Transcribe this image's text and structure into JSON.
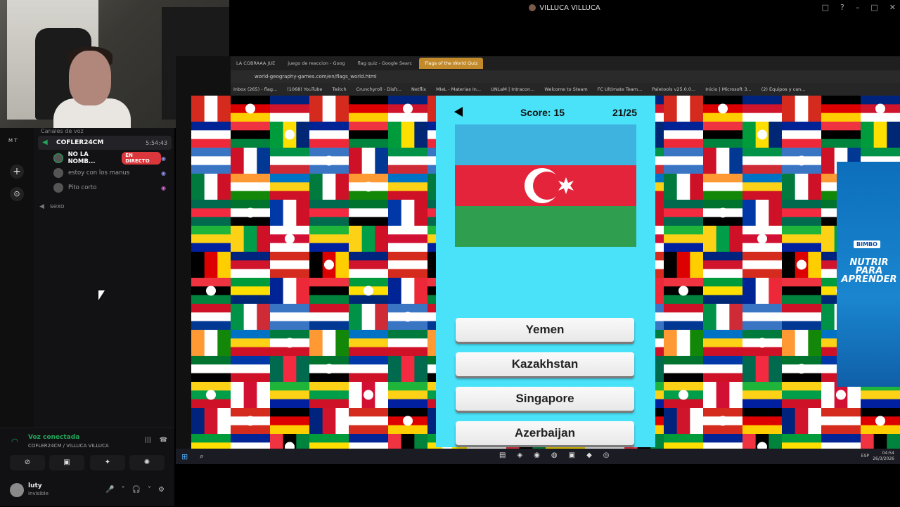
{
  "window": {
    "title": "VILLUCA VILLUCA",
    "controls": [
      "□",
      "?",
      "–",
      "□",
      "✕"
    ]
  },
  "server_bar": {
    "initials": "M T",
    "add_label": "+",
    "explore_label": "⊙"
  },
  "channels": {
    "section_title": "Canales de voz",
    "active_channel": {
      "name": "COFLER24CM",
      "timer": "5:54:43"
    },
    "users": [
      {
        "name": "NO LA NOMB...",
        "badge": "EN DIRECTO",
        "icon": "game-controller-icon"
      },
      {
        "name": "estoy con los manus",
        "badge": "",
        "icon": "game-controller-icon"
      },
      {
        "name": "Pito corto",
        "badge": "",
        "icon": "game-controller-icon"
      }
    ],
    "other_channel": "sexo"
  },
  "voice_panel": {
    "status": "Voz conectada",
    "path": "COFLER24CM / VILLUCA VILLUCA",
    "buttons": [
      "⊘",
      "▣",
      "✦",
      "✺"
    ]
  },
  "user_panel": {
    "username": "luty",
    "status": "Invisible",
    "controls": [
      "🎤",
      "˅",
      "🎧",
      "˅",
      "⚙"
    ]
  },
  "browser": {
    "tabs": [
      {
        "label": "LA COBRAAA JUE"
      },
      {
        "label": "juego de reaccion - Goog"
      },
      {
        "label": "flag quiz - Google Searc"
      },
      {
        "label": "Flags of the World Quiz",
        "active": true
      }
    ],
    "url": "world-geography-games.com/en/flags_world.html",
    "bookmarks": [
      "Inbox (265) - flag...",
      "(1068) YouTube",
      "Twitch",
      "Crunchyroll - Disfr...",
      "Netflix",
      "MIeL - Materias In...",
      "UNLaM | Intracon...",
      "Welcome to Steam",
      "FC Ultimate Team...",
      "Paletools v25.0.0...",
      "Inicio | Microsoft 3...",
      "(2) Equipos y can..."
    ]
  },
  "quiz": {
    "score_label": "Score: 15",
    "progress_label": "21/25",
    "answers": [
      "Yemen",
      "Kazakhstan",
      "Singapore",
      "Azerbaijan"
    ],
    "flag_colors": {
      "top": "#3fb3e0",
      "middle": "#e3243b",
      "bottom": "#2f9e4f"
    },
    "background_color": "#49e2f9"
  },
  "ad": {
    "brand": "BIMBO",
    "slogan": "NUTRIR PARA APRENDER"
  },
  "taskbar": {
    "lang": "ESP",
    "time": "04:54",
    "date": "26/3/2026"
  }
}
